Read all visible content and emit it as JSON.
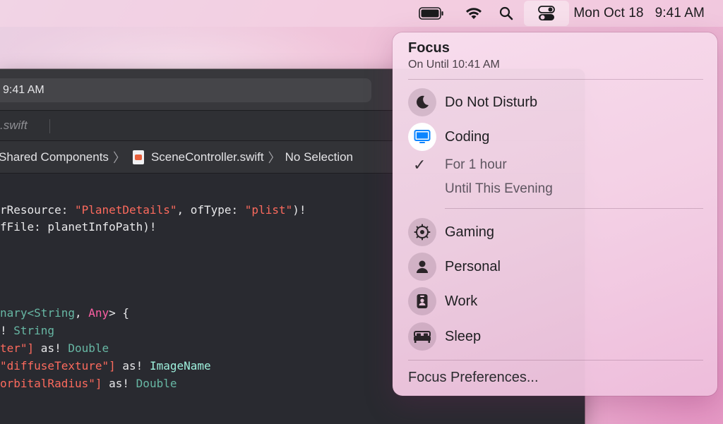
{
  "menubar": {
    "date": "Mon Oct 18",
    "time": "9:41 AM",
    "icons": [
      "battery-icon",
      "wifi-icon",
      "search-icon",
      "control-center-icon"
    ]
  },
  "xcode": {
    "status_text": "9:41 AM",
    "tab_label": ".swift",
    "breadcrumb": {
      "group": "Shared Components",
      "file": "SceneController.swift",
      "selection": "No Selection"
    }
  },
  "code": {
    "l1_a": "rResource: ",
    "l1_b": "\"PlanetDetails\"",
    "l1_c": ", ofType: ",
    "l1_d": "\"plist\"",
    "l1_e": ")!",
    "l2": "fFile: planetInfoPath)!",
    "l3_a": "nary<",
    "l3_b": "String",
    "l3_c": ", ",
    "l3_d": "Any",
    "l3_e": "> {",
    "l4_a": "! ",
    "l4_b": "String",
    "l5_a": "ter\"]",
    "l5_b": " as! ",
    "l5_c": "Double",
    "l6_a": "\"diffuseTexture\"]",
    "l6_b": " as! ",
    "l6_c": "ImageName",
    "l7_a": "orbitalRadius\"]",
    "l7_b": " as! ",
    "l7_c": "Double"
  },
  "focus": {
    "title": "Focus",
    "subtitle": "On Until 10:41 AM",
    "modes": [
      {
        "label": "Do Not Disturb",
        "icon": "moon-icon"
      },
      {
        "label": "Coding",
        "icon": "monitor-icon",
        "active": true
      },
      {
        "label": "Gaming",
        "icon": "gear-icon"
      },
      {
        "label": "Personal",
        "icon": "person-icon"
      },
      {
        "label": "Work",
        "icon": "badge-icon"
      },
      {
        "label": "Sleep",
        "icon": "bed-icon"
      }
    ],
    "coding_options": [
      "For 1 hour",
      "Until This Evening"
    ],
    "preferences": "Focus Preferences..."
  }
}
